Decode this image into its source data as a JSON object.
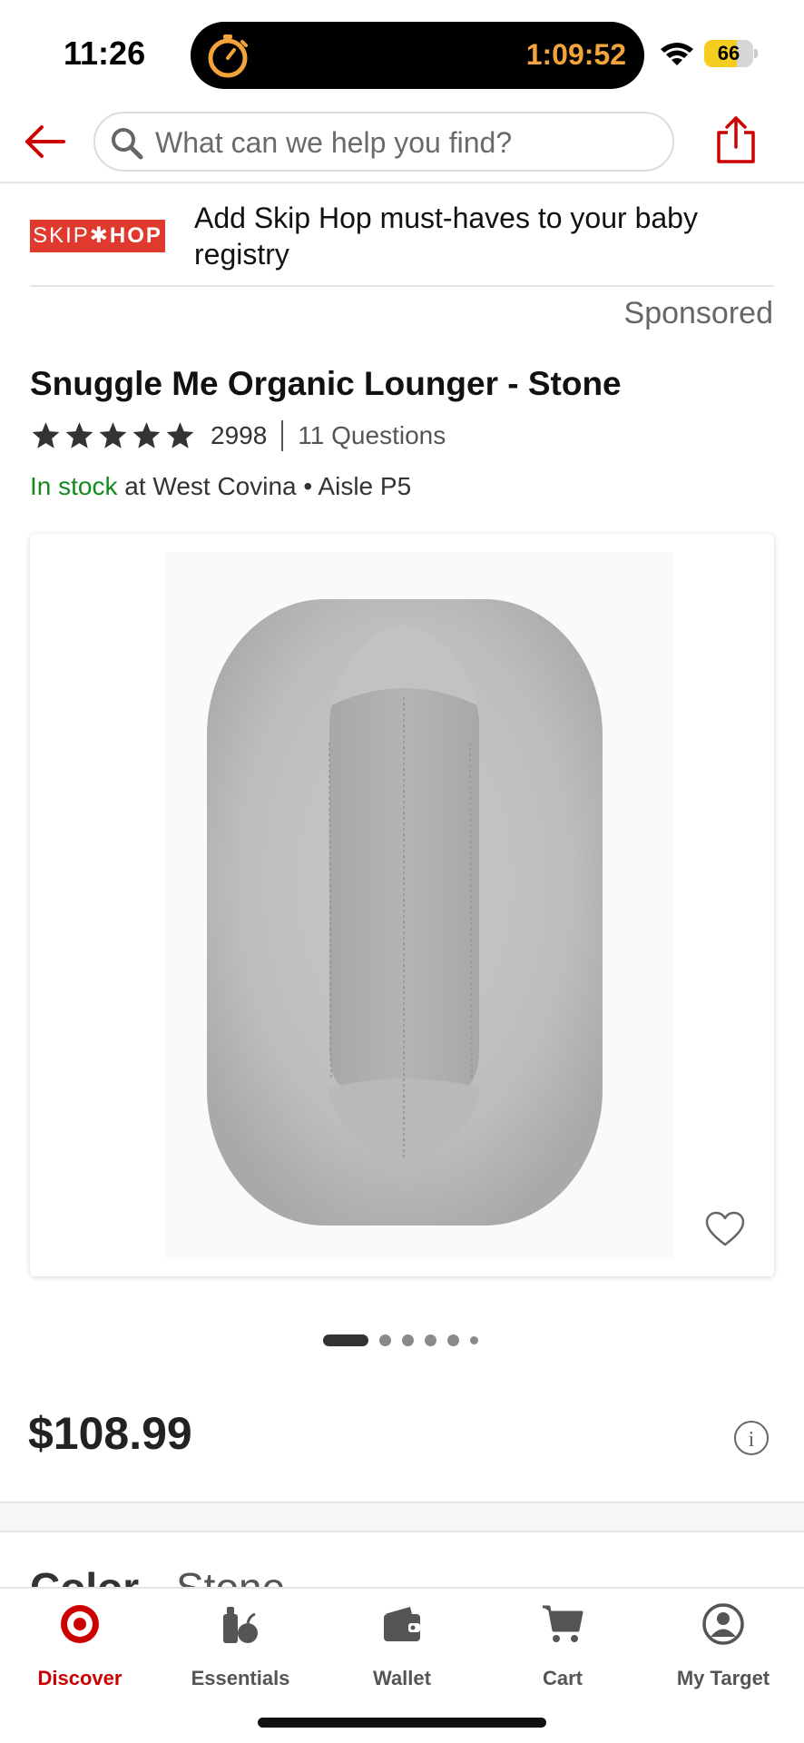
{
  "status_bar": {
    "time": "11:26",
    "timer": "1:09:52",
    "battery": "66",
    "battery_level_percent": 66,
    "timer_color": "#f2a33a"
  },
  "header": {
    "search_placeholder": "What can we help you find?",
    "back_icon": "back-arrow-icon",
    "share_icon": "share-icon"
  },
  "promo": {
    "logo_text_left": "SKIP",
    "logo_text_mid": "✱",
    "logo_text_right": "HOP",
    "text": "Add Skip Hop must-haves to your baby registry",
    "sponsored_label": "Sponsored"
  },
  "product": {
    "title": "Snuggle Me Organic Lounger - Stone",
    "stars": 5,
    "rating_count": "2998",
    "questions": "11 Questions",
    "stock_status": "In stock",
    "stock_location": " at West Covina • Aisle P5",
    "image_count": 6,
    "active_image": 1,
    "price": "$108.99",
    "color_label": "Color",
    "color_separator": " - ",
    "color_value": "Stone"
  },
  "tabbar": {
    "tabs": [
      {
        "label": "Discover",
        "icon": "target-logo-icon",
        "active": true
      },
      {
        "label": "Essentials",
        "icon": "essentials-icon",
        "active": false
      },
      {
        "label": "Wallet",
        "icon": "wallet-icon",
        "active": false
      },
      {
        "label": "Cart",
        "icon": "cart-icon",
        "active": false
      },
      {
        "label": "My Target",
        "icon": "account-icon",
        "active": false
      }
    ]
  },
  "colors": {
    "brand_red": "#cc0000",
    "in_stock_green": "#138a1e",
    "skiphop_red": "#e03a2f"
  }
}
